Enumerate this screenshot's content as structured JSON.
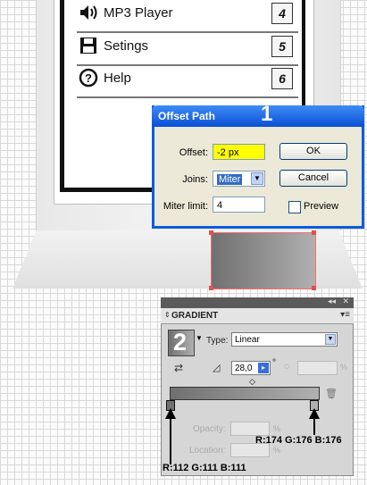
{
  "menu": {
    "items": [
      {
        "label": "MP3 Player",
        "number": "4",
        "icon": "speaker-icon"
      },
      {
        "label": "Setings",
        "number": "5",
        "icon": "floppy-disk-icon"
      },
      {
        "label": "Help",
        "number": "6",
        "icon": "question-icon"
      }
    ]
  },
  "dialog": {
    "title": "Offset Path",
    "step_number": "1",
    "offset_label": "Offset:",
    "offset_value": "-2 px",
    "joins_label": "Joins:",
    "joins_value": "Miter",
    "miter_label": "Miter limit:",
    "miter_value": "4",
    "ok_label": "OK",
    "cancel_label": "Cancel",
    "preview_label": "Preview",
    "accent": "#0a5ce0",
    "highlight": "#ffff00"
  },
  "gradient_panel": {
    "title": "GRADIENT",
    "step_number": "2",
    "type_label": "Type:",
    "type_value": "Linear",
    "angle_value": "28,0",
    "degree_symbol": "°",
    "aspect_unit": "%",
    "opacity_label": "Opacity:",
    "opacity_unit": "%",
    "location_label": "Location:",
    "location_unit": "%",
    "gradient_start_color": "#707070",
    "gradient_end_color": "#b0b0b0"
  },
  "annotations": {
    "right_stop": "R:174 G:176 B:176",
    "left_stop": "R:112 G:111 B:111"
  }
}
